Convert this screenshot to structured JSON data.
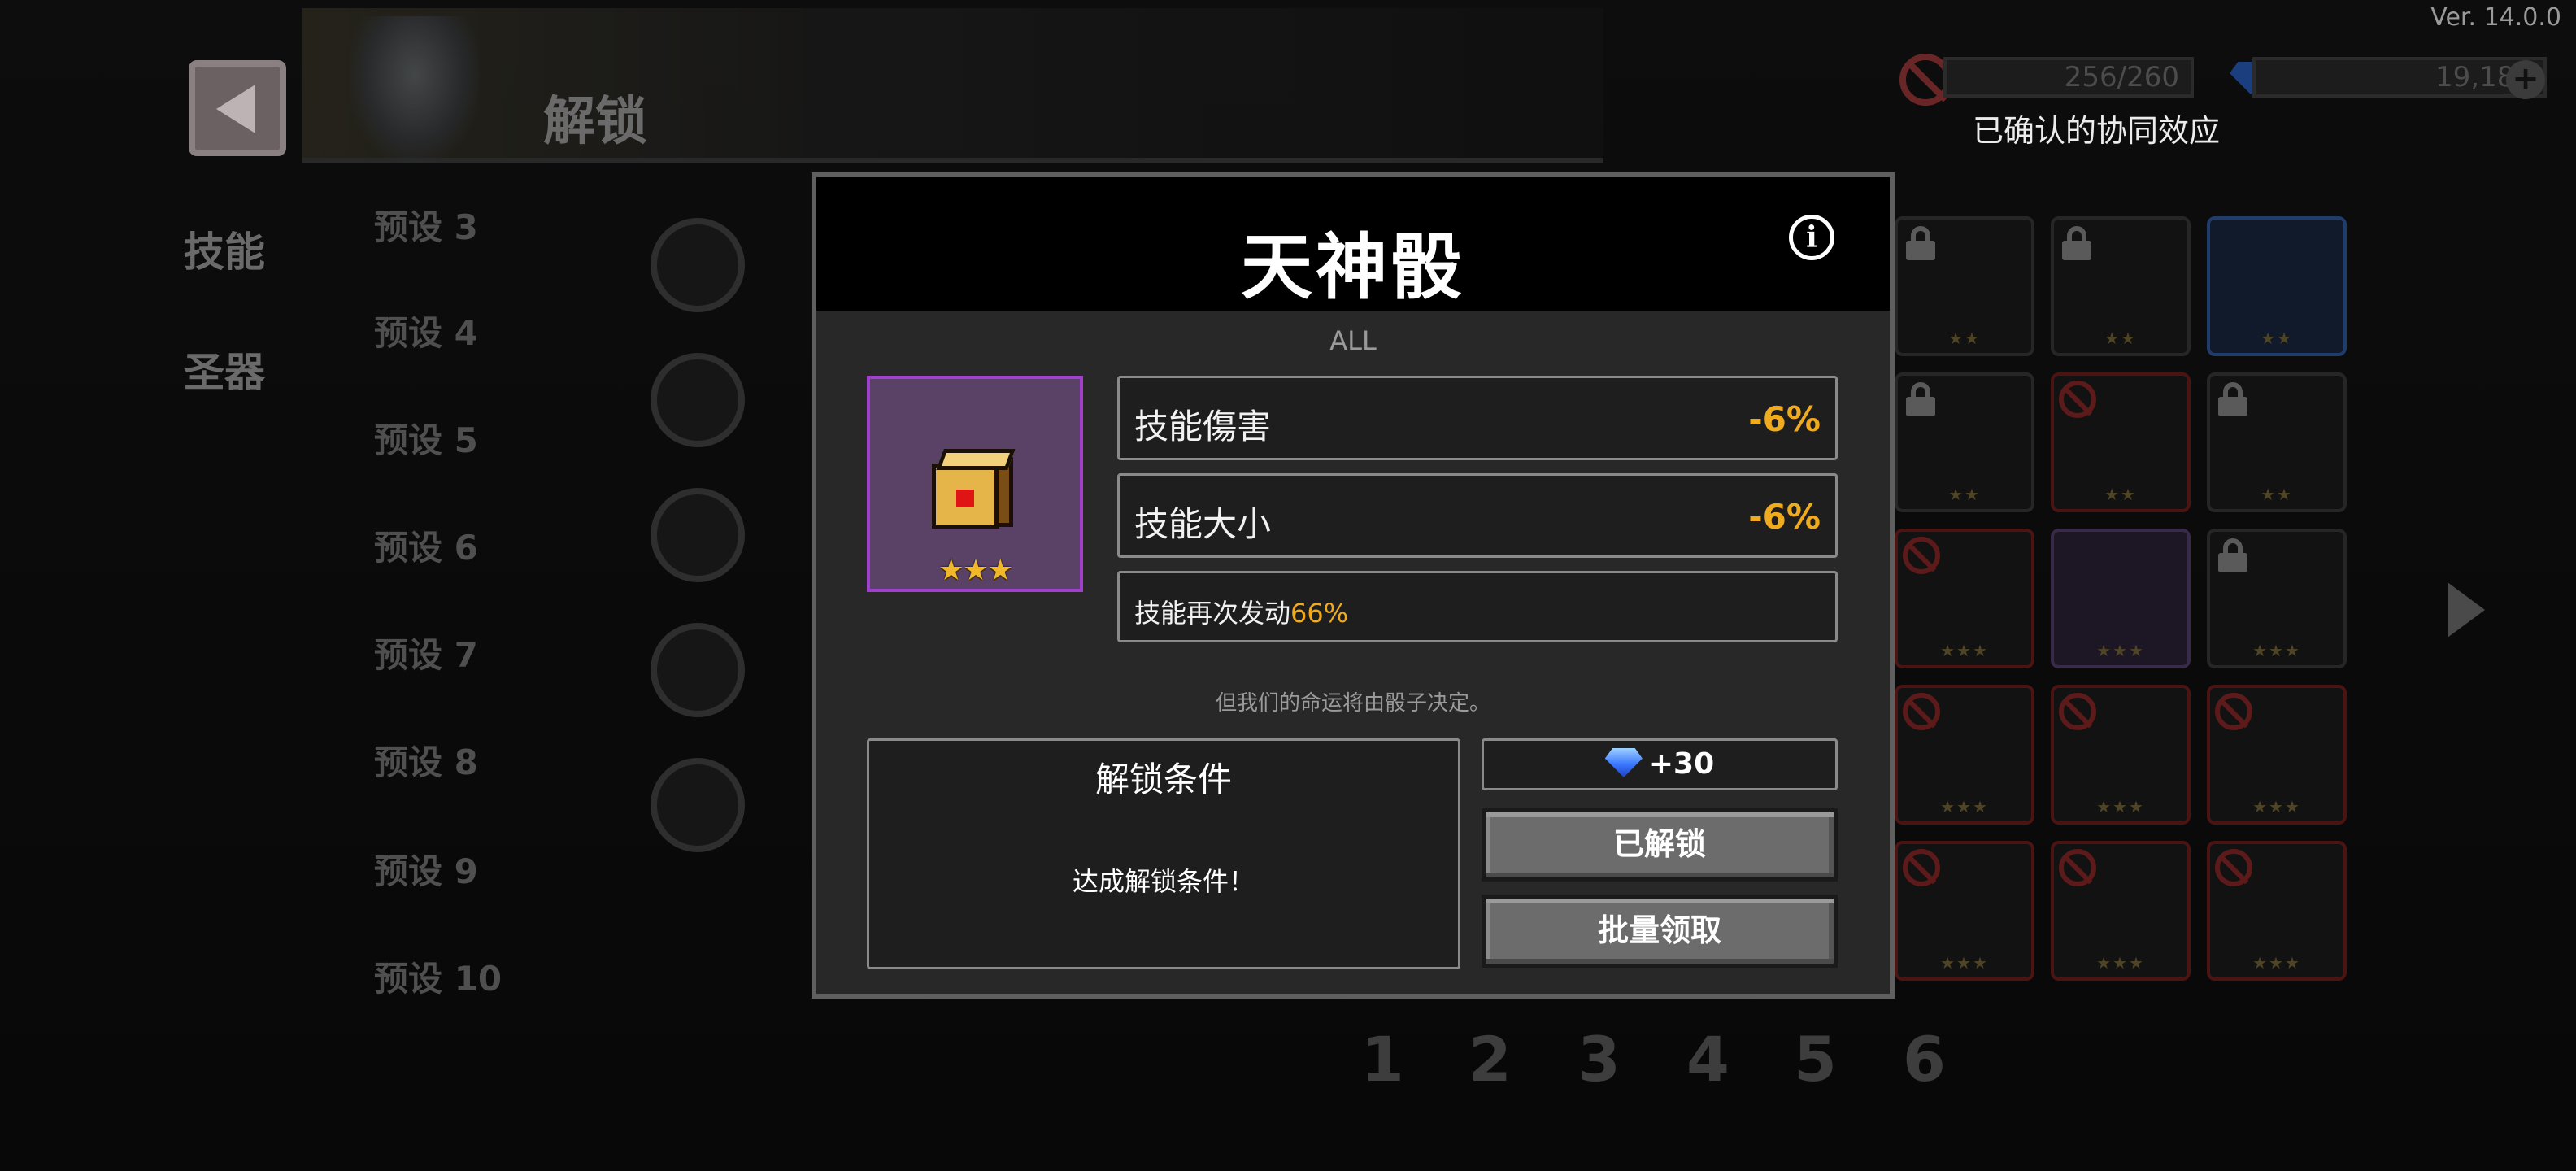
{
  "version": "Ver. 14.0.0",
  "header": {
    "title": "解锁"
  },
  "side_tabs": [
    "技能",
    "圣器"
  ],
  "presets": [
    "预设 3",
    "预设 4",
    "预设 5",
    "预设 6",
    "预设 7",
    "预设 8",
    "预设 9",
    "预设 10"
  ],
  "top_stats": {
    "count": "256/260",
    "gems": "19,180",
    "plus": "+"
  },
  "synergy_label": "已确认的协同效应",
  "pages": [
    "1",
    "2",
    "3",
    "4",
    "5",
    "6"
  ],
  "modal": {
    "title": "天神骰",
    "info": "i",
    "category": "ALL",
    "item_stars": "★★★",
    "stats": [
      {
        "label": "技能傷害",
        "value": "-6%"
      },
      {
        "label": "技能大小",
        "value": "-6%"
      }
    ],
    "recast": {
      "label": "技能再次发动",
      "percent": "66%"
    },
    "flavor": "但我们的命运将由骰子决定。",
    "unlock": {
      "title": "解锁条件",
      "text": "达成解锁条件！"
    },
    "reward": "+30",
    "buttons": {
      "unlocked": "已解锁",
      "claim_all": "批量领取"
    }
  },
  "colors": {
    "accent_value": "#f0aa1e",
    "item_border": "#a23fd0",
    "item_bg": "#5a4266"
  }
}
